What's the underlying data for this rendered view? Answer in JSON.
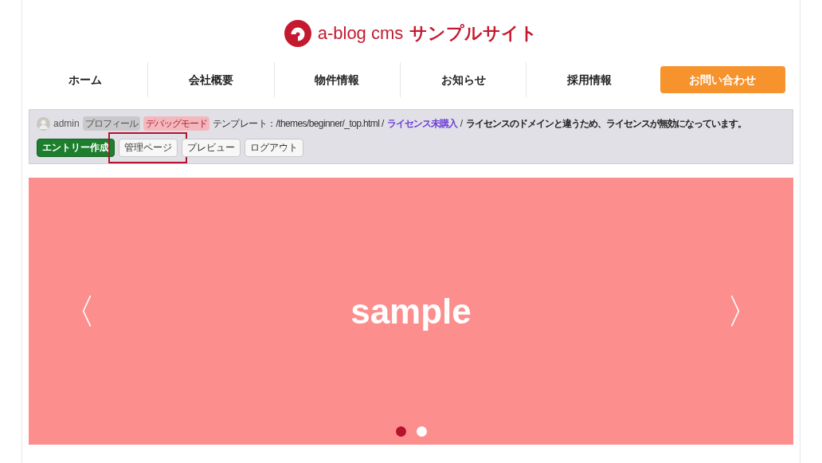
{
  "logo": {
    "prefix": "a-blog cms",
    "site_name": "サンプルサイト"
  },
  "nav": [
    {
      "label": "ホーム",
      "kind": "link"
    },
    {
      "label": "会社概要",
      "kind": "link"
    },
    {
      "label": "物件情報",
      "kind": "link"
    },
    {
      "label": "お知らせ",
      "kind": "link"
    },
    {
      "label": "採用情報",
      "kind": "link"
    },
    {
      "label": "お問い合わせ",
      "kind": "cta"
    }
  ],
  "admin_bar": {
    "user": "admin",
    "badges": [
      {
        "label": "プロフィール",
        "kind": "profile"
      },
      {
        "label": "デバッグモード",
        "kind": "debug"
      }
    ],
    "template": "テンプレート：/themes/beginner/_top.html /",
    "license_link": "ライセンス未購入",
    "separator": "/",
    "message": "ライセンスのドメインと違うため、ライセンスが無効になっています。",
    "buttons": [
      {
        "label": "エントリー作成",
        "kind": "primary",
        "highlighted": false
      },
      {
        "label": "管理ページ",
        "kind": "default",
        "highlighted": true
      },
      {
        "label": "プレビュー",
        "kind": "default",
        "highlighted": false
      },
      {
        "label": "ログアウト",
        "kind": "default",
        "highlighted": false
      }
    ]
  },
  "slider": {
    "caption": "sample",
    "prev": "〈",
    "next": "〉",
    "dots": [
      {
        "selected": true
      },
      {
        "selected": false
      }
    ]
  }
}
